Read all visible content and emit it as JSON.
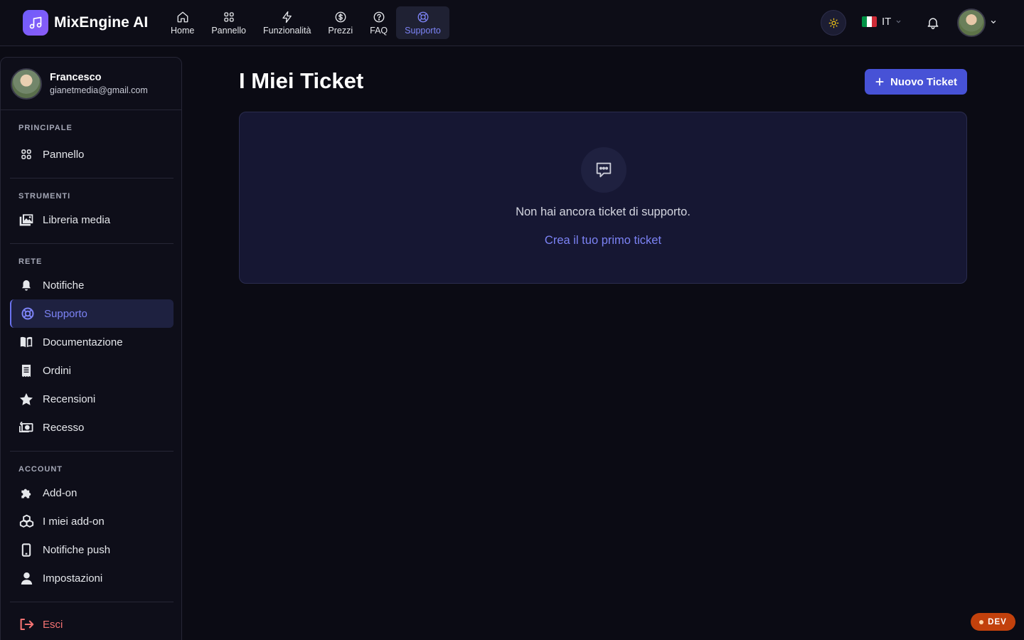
{
  "brand": {
    "name": "MixEngine AI",
    "icon": "music-note-icon",
    "accent": "#6d5dfc"
  },
  "nav": {
    "items": [
      {
        "label": "Home",
        "icon": "home-icon"
      },
      {
        "label": "Pannello",
        "icon": "grid-icon"
      },
      {
        "label": "Funzionalità",
        "icon": "bolt-icon"
      },
      {
        "label": "Prezzi",
        "icon": "dollar-icon"
      },
      {
        "label": "FAQ",
        "icon": "question-icon"
      },
      {
        "label": "Supporto",
        "icon": "lifebuoy-icon",
        "active": true
      }
    ]
  },
  "header": {
    "theme_icon": "sun-icon",
    "language": {
      "code": "IT",
      "flag": [
        "#009246",
        "#ffffff",
        "#ce2b37"
      ]
    },
    "notifications_icon": "bell-icon"
  },
  "user": {
    "name": "Francesco",
    "email": "gianetmedia@gmail.com"
  },
  "sidebar": {
    "sections": [
      {
        "label": "PRINCIPALE",
        "items": [
          {
            "label": "Pannello",
            "icon": "grid-icon"
          }
        ]
      },
      {
        "label": "STRUMENTI",
        "items": [
          {
            "label": "Libreria media",
            "icon": "photo-library-icon"
          }
        ]
      },
      {
        "label": "RETE",
        "items": [
          {
            "label": "Notifiche",
            "icon": "bell-icon"
          },
          {
            "label": "Supporto",
            "icon": "lifebuoy-icon",
            "active": true
          },
          {
            "label": "Documentazione",
            "icon": "book-icon"
          },
          {
            "label": "Ordini",
            "icon": "receipt-icon"
          },
          {
            "label": "Recensioni",
            "icon": "star-icon"
          },
          {
            "label": "Recesso",
            "icon": "money-refund-icon"
          }
        ]
      },
      {
        "label": "ACCOUNT",
        "items": [
          {
            "label": "Add-on",
            "icon": "puzzle-icon"
          },
          {
            "label": "I miei add-on",
            "icon": "cubes-icon"
          },
          {
            "label": "Notifiche push",
            "icon": "mobile-icon"
          },
          {
            "label": "Impostazioni",
            "icon": "user-icon"
          }
        ]
      }
    ],
    "logout": {
      "label": "Esci",
      "icon": "logout-icon",
      "color": "#f47272"
    }
  },
  "main": {
    "title": "I Miei Ticket",
    "new_ticket_label": "Nuovo Ticket",
    "empty_state": {
      "icon": "chat-bubble-icon",
      "message": "Non hai ancora ticket di supporto.",
      "cta": "Crea il tuo primo ticket"
    }
  },
  "env_badge": {
    "label": "DEV",
    "color": "#c2410c"
  }
}
